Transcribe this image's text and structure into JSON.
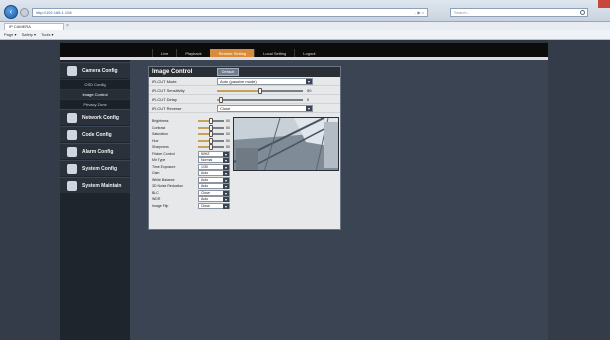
{
  "browser": {
    "address": "http://192.168.1.108",
    "address_hint": "- ▶ ×",
    "search_placeholder": "Search...",
    "tab_label": "IP CAMERA",
    "toolbar": [
      "Page ▾",
      "Safety ▾",
      "Tools ▾"
    ]
  },
  "topnav": [
    {
      "label": "Live",
      "active": false
    },
    {
      "label": "Playback",
      "active": false
    },
    {
      "label": "Remote Setting",
      "active": true
    },
    {
      "label": "Local Setting",
      "active": false
    },
    {
      "label": "Logout",
      "active": false
    }
  ],
  "sidebar": {
    "sections": [
      {
        "label": "Camera Config",
        "icon": "camera-icon",
        "items": [
          {
            "label": "OSD Config",
            "active": false
          },
          {
            "label": "Image Control",
            "active": true
          },
          {
            "label": "Privacy Zone",
            "active": false
          }
        ]
      },
      {
        "label": "Network Config",
        "icon": "network-icon",
        "items": []
      },
      {
        "label": "Code Config",
        "icon": "code-icon",
        "items": []
      },
      {
        "label": "Alarm Config",
        "icon": "alarm-icon",
        "items": []
      },
      {
        "label": "System Config",
        "icon": "system-icon",
        "items": []
      },
      {
        "label": "System Maintain",
        "icon": "tools-icon",
        "items": []
      }
    ]
  },
  "panel": {
    "title": "Image Control",
    "default_label": "Default",
    "ircut_mode": {
      "label": "IR-CUT Mode",
      "value": "Auto (passive mode)"
    },
    "ircut_sensitivity": {
      "label": "IR-CUT Sensitivity",
      "value": "50",
      "level": 0.5
    },
    "ircut_delay": {
      "label": "IR-CUT Delay",
      "value": "0",
      "level": 0.05
    },
    "ircut_reverse": {
      "label": "IR-CUT Reverse",
      "value": "Close"
    },
    "sliders": [
      {
        "label": "Brightness",
        "value": "50",
        "level": 0.5
      },
      {
        "label": "Contrast",
        "value": "50",
        "level": 0.5
      },
      {
        "label": "Saturation",
        "value": "50",
        "level": 0.5
      },
      {
        "label": "Hue",
        "value": "50",
        "level": 0.5
      },
      {
        "label": "Sharpness",
        "value": "50",
        "level": 0.5
      }
    ],
    "selects": [
      {
        "label": "Flicker Control",
        "value": "50HZ"
      },
      {
        "label": "Mir Type",
        "value": "Normal"
      },
      {
        "label": "Time Exposure",
        "value": "1/30"
      },
      {
        "label": "Gain",
        "value": "Auto"
      },
      {
        "label": "White Balance",
        "value": "Auto"
      },
      {
        "label": "3D Noise Reduction",
        "value": "Auto"
      },
      {
        "label": "BLC",
        "value": "Close"
      },
      {
        "label": "WDR",
        "value": "Auto"
      },
      {
        "label": "Image Flip",
        "value": "Close"
      }
    ]
  },
  "colors": {
    "accent": "#d98b3a",
    "header": "#0c0c0c",
    "panel": "#e6e8ea",
    "background": "#2e3641"
  }
}
